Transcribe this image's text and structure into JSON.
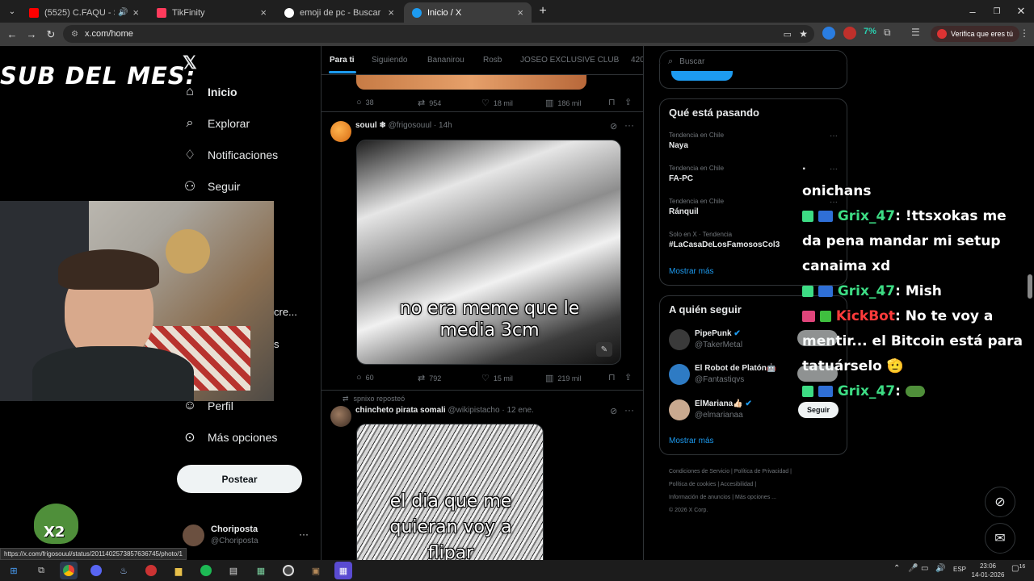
{
  "browser": {
    "tabs": [
      {
        "title": "(5525) C.FAQU - SCIROCCO",
        "fav_color": "#ff0000",
        "fav_text": "YT"
      },
      {
        "title": "TikFinity",
        "fav_color": "#ff3b5c",
        "fav_text": "T"
      },
      {
        "title": "emoji de pc - Buscar con Google",
        "fav_color": "#ffffff",
        "fav_text": "G"
      },
      {
        "title": "Inicio / X",
        "fav_color": "#1d9bf0",
        "fav_text": "X"
      }
    ],
    "url": "x.com/home",
    "profile_label": "Verifica que eres tú",
    "status_url": "https://x.com/frigosouul/status/2011402573857636745/photo/1"
  },
  "overlay": {
    "sub_title": "SUB DEL MES:",
    "badge": "X2"
  },
  "nav": {
    "items": [
      "Inicio",
      "Explorar",
      "Notificaciones",
      "Seguir",
      "Perfil",
      "Más opciones"
    ],
    "partial_1": "cre...",
    "partial_2": "s",
    "post_button": "Postear",
    "account_name": "Choriposta",
    "account_handle": "@Choriposta"
  },
  "feed": {
    "tabs": [
      "Para ti",
      "Siguiendo",
      "Bananirou",
      "Rosb",
      "JOSEO EXCLUSIVE CLUB",
      "420"
    ],
    "top_actions": {
      "replies": "38",
      "reposts": "954",
      "likes": "18 mil",
      "views": "186 mil"
    },
    "tweet1": {
      "name": "souul ❄",
      "handle": "@frigosouul",
      "time": "14h",
      "caption": "no era meme que le media 3cm",
      "replies": "60",
      "reposts": "792",
      "likes": "15 mil",
      "views": "219 mil"
    },
    "tweet2": {
      "repost_note": "spnixo reposteó",
      "name": "chincheto pirata somali",
      "handle": "@wikipistacho",
      "time": "12 ene.",
      "caption": "el dia que me quieran voy a flipar"
    }
  },
  "sidebar": {
    "search_placeholder": "Buscar",
    "trends_title": "Qué está pasando",
    "trends": [
      {
        "category": "Tendencia en Chile",
        "name": "Naya"
      },
      {
        "category": "Tendencia en Chile",
        "name": "FA-PC"
      },
      {
        "category": "Tendencia en Chile",
        "name": "Ránquil"
      },
      {
        "category": "Solo en X · Tendencia",
        "name": "#LaCasaDeLosFamososCol3"
      }
    ],
    "show_more": "Mostrar más",
    "follow_title": "A quién seguir",
    "follow": [
      {
        "name": "PipePunk",
        "handle": "@TakerMetal",
        "button": "Seguir"
      },
      {
        "name": "El Robot de Platón🤖",
        "handle": "@Fantastiqvs",
        "button": "Seguir"
      },
      {
        "name": "ElMariana👍🏻",
        "handle": "@elmarianaa",
        "button": "Seguir"
      }
    ],
    "show_more_2": "Mostrar más",
    "footer": [
      "Condiciones de Servicio",
      "Política de Privacidad",
      "Política de cookies",
      "Accesibilidad",
      "Información de anuncios",
      "Más opciones ...",
      "© 2026 X Corp."
    ]
  },
  "chat": {
    "lines": [
      {
        "type": "plain",
        "text": "onichans"
      },
      {
        "type": "msg",
        "user": "Grix_47",
        "user_color": "#3ddc84",
        "text": "!ttsxokas me da pena mandar mi setup canaima xd"
      },
      {
        "type": "msg",
        "user": "Grix_47",
        "user_color": "#3ddc84",
        "text": "Mish"
      },
      {
        "type": "msg",
        "user": "KickBot",
        "user_color": "#ff3b3b",
        "text": "No te voy a mentir... el Bitcoin está para tatuárselo 🫡"
      },
      {
        "type": "msg",
        "user": "Grix_47",
        "user_color": "#3ddc84",
        "text": ""
      }
    ]
  },
  "taskbar": {
    "lang": "ESP",
    "time": "23:06",
    "date": "14-01-2026",
    "notif_count": "16"
  },
  "colors": {
    "accent": "#1d9bf0",
    "bg": "#000000",
    "border": "#2f3336"
  }
}
